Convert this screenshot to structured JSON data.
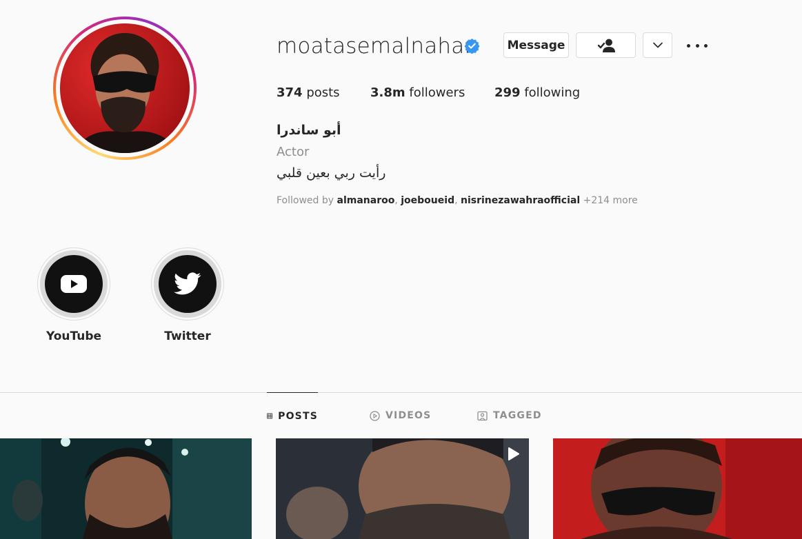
{
  "profile": {
    "username": "moatasemalnahar",
    "verified": true,
    "buttons": {
      "message": "Message",
      "following_icon": "person-check-icon",
      "dropdown_icon": "chevron-down-icon",
      "more_icon": "more-horizontal-icon"
    },
    "stats": {
      "posts_count": "374",
      "posts_label": "posts",
      "followers_count": "3.8m",
      "followers_label": "followers",
      "following_count": "299",
      "following_label": "following"
    },
    "bio": {
      "name": "أبو ساندرا",
      "category": "Actor",
      "text": "رأيت ربي بعين قلبي"
    },
    "followed_by": {
      "prefix": "Followed by",
      "users": [
        "almanaroo",
        "joeboueid",
        "nisrinezawahraofficial"
      ],
      "more": "+214 more"
    }
  },
  "highlights": [
    {
      "label": "YouTube",
      "icon": "youtube-icon"
    },
    {
      "label": "Twitter",
      "icon": "twitter-icon"
    }
  ],
  "tabs": [
    {
      "label": "POSTS",
      "icon": "grid-icon",
      "active": true
    },
    {
      "label": "VIDEOS",
      "icon": "play-circle-icon",
      "active": false
    },
    {
      "label": "TAGGED",
      "icon": "tagged-icon",
      "active": false
    }
  ],
  "colors": {
    "verified": "#3897f0",
    "text_primary": "#262626",
    "text_secondary": "#8e8e8e",
    "border": "#dbdbdb",
    "avatar_background": "#c81e1e"
  }
}
